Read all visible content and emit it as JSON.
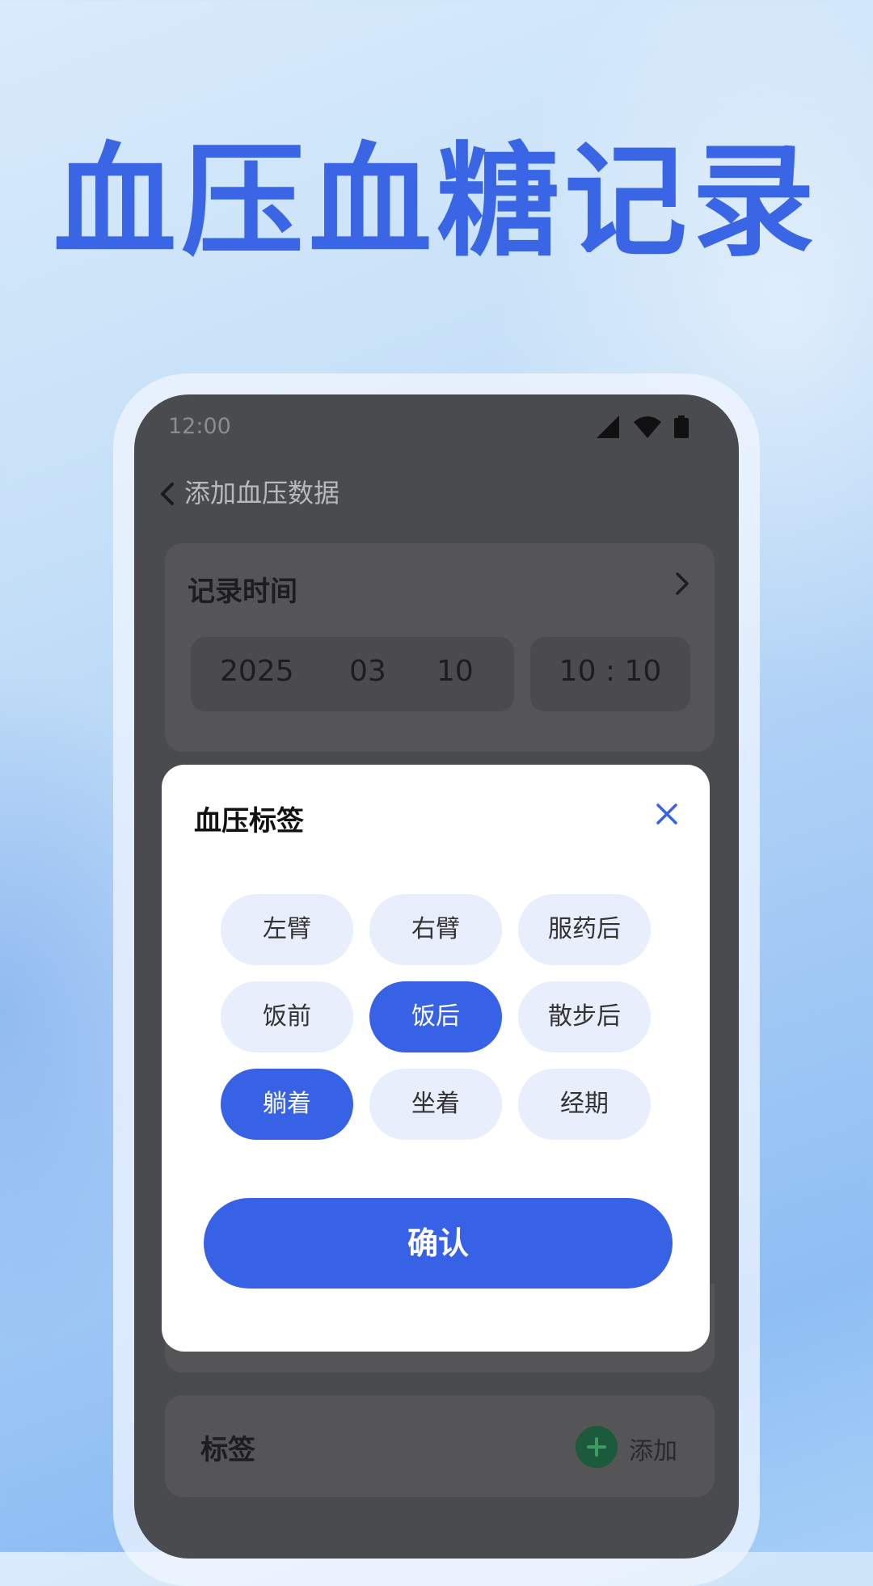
{
  "promo": {
    "headline": "血压血糖记录"
  },
  "status_bar": {
    "time": "12:00",
    "icons": [
      "signal-icon",
      "wifi-icon",
      "battery-icon"
    ]
  },
  "nav": {
    "back_icon": "chevron-left-icon",
    "title": "添加血压数据"
  },
  "record_time": {
    "label": "记录时间",
    "year": "2025",
    "month": "03",
    "day": "10",
    "time": "10 : 10"
  },
  "tags_row": {
    "label": "标签",
    "add_label": "添加"
  },
  "modal": {
    "title": "血压标签",
    "chips": [
      {
        "label": "左臂",
        "selected": false
      },
      {
        "label": "右臂",
        "selected": false
      },
      {
        "label": "服药后",
        "selected": false
      },
      {
        "label": "饭前",
        "selected": false
      },
      {
        "label": "饭后",
        "selected": true
      },
      {
        "label": "散步后",
        "selected": false
      },
      {
        "label": "躺着",
        "selected": true
      },
      {
        "label": "坐着",
        "selected": false
      },
      {
        "label": "经期",
        "selected": false
      }
    ],
    "confirm_label": "确认"
  },
  "colors": {
    "accent": "#3762e6",
    "chip_bg": "#e8eefb",
    "headline": "#3a66e6",
    "overlay_bg": "#4a4b4e",
    "add_green": "#1b5a3a"
  }
}
